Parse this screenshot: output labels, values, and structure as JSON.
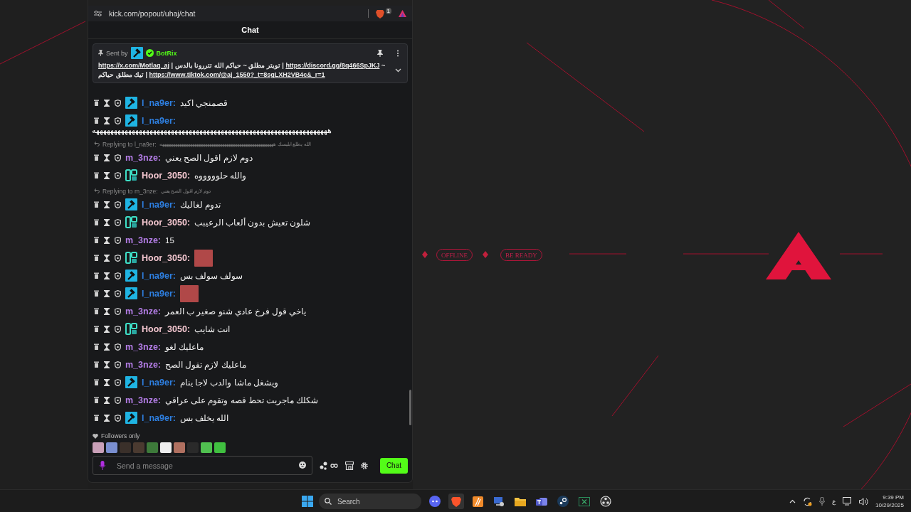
{
  "browser": {
    "url": "kick.com/popout/uhaj/chat",
    "shield_count": "1"
  },
  "chat": {
    "title": "Chat",
    "pinned": {
      "sent_by": "Sent by",
      "sender": "BotRix",
      "x_link": "https://x.com/Motlaq_aj",
      "x_caption": "| تويتر مطلق ~ حياكم الله تتررونا بالدس |",
      "discord_link": "https://discord.gg/8q466SpJKJ",
      "tiktok_caption": "~ تيك مطلق حياكم |",
      "tiktok_link": "https://www.tiktok.com/@aj_1550?_t=8sgLXH2VB4c&_r=1"
    },
    "messages": [
      {
        "user": "l_na9er:",
        "color": "#2e7fe0",
        "badges": [
          {
            "kind": "moderator"
          }
        ],
        "kind": "text",
        "text": "قصمنجي اكيد"
      },
      {
        "user": "l_na9er:",
        "color": "#2e7fe0",
        "badges": [
          {
            "kind": "moderator"
          }
        ],
        "kind": "long",
        "text": "ههههههههههههههههههههههههههههههههههههههههههههههههههههههههههههههههههه"
      },
      {
        "reply": {
          "label": "Replying to l_na9er:",
          "quote": "الله يطلع ابليسك هههههههههههههههههههههههههههههههههههههههههههههههههههههه"
        },
        "user": "m_3nze:",
        "color": "#b57ee8",
        "kind": "text",
        "text": "دوم لازم اقول الصح يعني"
      },
      {
        "user": "Hoor_3050:",
        "color": "#f3c6cf",
        "badges": [
          {
            "kind": "og"
          }
        ],
        "kind": "text",
        "text": "والله حلوووووه"
      },
      {
        "reply": {
          "label": "Replying to m_3nze:",
          "quote": "دوم لازم اقول الصح يعني"
        },
        "user": "l_na9er:",
        "color": "#2e7fe0",
        "badges": [
          {
            "kind": "moderator"
          }
        ],
        "kind": "text",
        "text": "تدوم لغاليك"
      },
      {
        "user": "Hoor_3050:",
        "color": "#f3c6cf",
        "badges": [
          {
            "kind": "og"
          }
        ],
        "kind": "text",
        "text": "شلون تعيش بدون ألعاب الرعيبب"
      },
      {
        "user": "m_3nze:",
        "color": "#b57ee8",
        "kind": "text",
        "text": "15"
      },
      {
        "user": "Hoor_3050:",
        "color": "#f3c6cf",
        "badges": [
          {
            "kind": "og"
          }
        ],
        "kind": "emote"
      },
      {
        "user": "l_na9er:",
        "color": "#2e7fe0",
        "badges": [
          {
            "kind": "moderator"
          }
        ],
        "kind": "text",
        "text": "سولف سولف بس"
      },
      {
        "user": "l_na9er:",
        "color": "#2e7fe0",
        "badges": [
          {
            "kind": "moderator"
          }
        ],
        "kind": "emote"
      },
      {
        "user": "m_3nze:",
        "color": "#b57ee8",
        "kind": "text",
        "text": "ياخي قول فرخ عادي شنو صغير ب العمر"
      },
      {
        "user": "Hoor_3050:",
        "color": "#f3c6cf",
        "badges": [
          {
            "kind": "og"
          }
        ],
        "kind": "text",
        "text": "انت شايب"
      },
      {
        "user": "m_3nze:",
        "color": "#b57ee8",
        "kind": "text",
        "text": "ماعليك لغو"
      },
      {
        "user": "m_3nze:",
        "color": "#b57ee8",
        "kind": "text",
        "text": "ماعليك لازم تقول الصح"
      },
      {
        "user": "l_na9er:",
        "color": "#2e7fe0",
        "badges": [
          {
            "kind": "moderator"
          }
        ],
        "kind": "text",
        "text": "ويشغل ماشا والدب لاجا ينام"
      },
      {
        "user": "m_3nze:",
        "color": "#b57ee8",
        "kind": "text",
        "text": "شكلك ماجربت تحط قصه وتقوم على عراقي"
      },
      {
        "user": "l_na9er:",
        "color": "#2e7fe0",
        "badges": [
          {
            "kind": "moderator"
          }
        ],
        "kind": "text",
        "text": "الله يخلف بس"
      }
    ],
    "mode": "Followers only",
    "input": {
      "placeholder": "Send a message"
    },
    "send_button": "Chat"
  },
  "wallpaper": {
    "status_pill": "OFFLINE",
    "tagline_pill": "BE READY"
  },
  "taskbar": {
    "search": "Search",
    "language": "ع",
    "time": "9:39 PM",
    "date": "10/29/2025"
  }
}
